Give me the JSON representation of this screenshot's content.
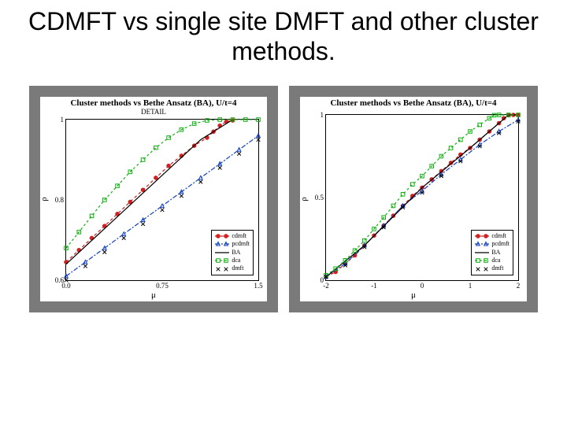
{
  "title": "CDMFT vs single site DMFT and  other cluster methods.",
  "chart_data": [
    {
      "type": "line",
      "title": "Cluster methods vs Bethe Ansatz (BA), U/t=4",
      "subtitle": "DETAIL",
      "xlabel": "μ",
      "ylabel": "ρ",
      "xlim": [
        0.5,
        2.0
      ],
      "ylim": [
        0.6,
        1.0
      ],
      "xticks": [
        0.5,
        1.25,
        2.0
      ],
      "xtick_labels": [
        "0.0",
        "0.75",
        "1.5"
      ],
      "yticks": [
        0.6,
        0.8,
        1.0
      ],
      "ytick_labels": [
        "0.6",
        "0.8",
        "1"
      ],
      "series": [
        {
          "name": "cdmft",
          "color": "#d02020",
          "marker": "circle-filled",
          "dash": "4,3",
          "x": [
            0.5,
            0.6,
            0.7,
            0.8,
            0.9,
            1.0,
            1.1,
            1.2,
            1.3,
            1.4,
            1.5,
            1.6,
            1.65,
            1.7,
            1.75,
            1.8
          ],
          "y": [
            0.645,
            0.675,
            0.705,
            0.735,
            0.765,
            0.795,
            0.825,
            0.855,
            0.885,
            0.91,
            0.935,
            0.955,
            0.97,
            0.985,
            0.995,
            0.998
          ]
        },
        {
          "name": "pcdmft",
          "color": "#1040c0",
          "marker": "triangle-open",
          "dash": "6,2,2,2",
          "x": [
            0.5,
            0.65,
            0.8,
            0.95,
            1.1,
            1.25,
            1.4,
            1.55,
            1.7,
            1.85,
            2.0
          ],
          "y": [
            0.61,
            0.645,
            0.68,
            0.715,
            0.75,
            0.785,
            0.82,
            0.855,
            0.89,
            0.925,
            0.96
          ]
        },
        {
          "name": "BA",
          "color": "#000000",
          "marker": "none",
          "dash": "",
          "x": [
            0.5,
            1.55,
            1.8
          ],
          "y": [
            0.64,
            0.95,
            1.0
          ]
        },
        {
          "name": "dca",
          "color": "#10b010",
          "marker": "square-open",
          "dash": "3,3",
          "x": [
            0.5,
            0.6,
            0.7,
            0.8,
            0.9,
            1.0,
            1.1,
            1.2,
            1.3,
            1.4,
            1.5,
            1.6,
            1.7,
            1.8,
            1.9,
            2.0
          ],
          "y": [
            0.68,
            0.72,
            0.76,
            0.8,
            0.835,
            0.87,
            0.9,
            0.93,
            0.955,
            0.975,
            0.99,
            0.998,
            1.0,
            1.0,
            1.0,
            1.0
          ]
        },
        {
          "name": "dmft",
          "color": "#000000",
          "marker": "x",
          "dash": "none",
          "x": [
            0.5,
            0.65,
            0.8,
            0.95,
            1.1,
            1.25,
            1.4,
            1.55,
            1.7,
            1.85,
            2.0
          ],
          "y": [
            0.6,
            0.635,
            0.67,
            0.705,
            0.74,
            0.775,
            0.81,
            0.845,
            0.88,
            0.915,
            0.95
          ]
        }
      ],
      "legend_pos": "lower-right"
    },
    {
      "type": "line",
      "title": "Cluster methods vs Bethe Ansatz (BA), U/t=4",
      "subtitle": "",
      "xlabel": "μ",
      "ylabel": "ρ",
      "xlim": [
        -2.0,
        2.0
      ],
      "ylim": [
        0.0,
        1.0
      ],
      "xticks": [
        -2,
        -1,
        0,
        1,
        2
      ],
      "xtick_labels": [
        "-2",
        "-1",
        "0",
        "1",
        "2"
      ],
      "yticks": [
        0.0,
        0.5,
        1.0
      ],
      "ytick_labels": [
        "0",
        "0.5",
        "1"
      ],
      "series": [
        {
          "name": "cdmft",
          "color": "#d02020",
          "marker": "circle-filled",
          "dash": "4,3",
          "x": [
            -2.0,
            -1.8,
            -1.6,
            -1.4,
            -1.2,
            -1.0,
            -0.8,
            -0.6,
            -0.4,
            -0.2,
            0.0,
            0.2,
            0.4,
            0.6,
            0.8,
            1.0,
            1.2,
            1.4,
            1.6,
            1.7,
            1.8,
            1.9,
            2.0
          ],
          "y": [
            0.02,
            0.05,
            0.1,
            0.15,
            0.21,
            0.27,
            0.33,
            0.39,
            0.45,
            0.51,
            0.56,
            0.61,
            0.66,
            0.71,
            0.76,
            0.8,
            0.85,
            0.9,
            0.95,
            0.98,
            0.998,
            1.0,
            1.0
          ]
        },
        {
          "name": "pcdmft",
          "color": "#1040c0",
          "marker": "triangle-open",
          "dash": "6,2,2,2",
          "x": [
            -2.0,
            -1.6,
            -1.2,
            -0.8,
            -0.4,
            0.0,
            0.4,
            0.8,
            1.2,
            1.6,
            2.0
          ],
          "y": [
            0.02,
            0.1,
            0.21,
            0.33,
            0.45,
            0.54,
            0.64,
            0.73,
            0.82,
            0.9,
            0.97
          ]
        },
        {
          "name": "BA",
          "color": "#000000",
          "marker": "none",
          "dash": "",
          "x": [
            -2.0,
            -1.2,
            0.0,
            1.0,
            1.6,
            1.8,
            2.0
          ],
          "y": [
            0.02,
            0.21,
            0.56,
            0.8,
            0.95,
            1.0,
            1.0
          ]
        },
        {
          "name": "dca",
          "color": "#10b010",
          "marker": "square-open",
          "dash": "3,3",
          "x": [
            -2.0,
            -1.8,
            -1.6,
            -1.4,
            -1.2,
            -1.0,
            -0.8,
            -0.6,
            -0.4,
            -0.2,
            0.0,
            0.2,
            0.4,
            0.6,
            0.8,
            1.0,
            1.2,
            1.4,
            1.5,
            1.6,
            1.8,
            2.0
          ],
          "y": [
            0.03,
            0.07,
            0.12,
            0.18,
            0.24,
            0.31,
            0.38,
            0.45,
            0.52,
            0.58,
            0.63,
            0.69,
            0.75,
            0.8,
            0.85,
            0.9,
            0.94,
            0.98,
            0.998,
            1.0,
            1.0,
            1.0
          ]
        },
        {
          "name": "dmft",
          "color": "#000000",
          "marker": "x",
          "dash": "none",
          "x": [
            -2.0,
            -1.6,
            -1.2,
            -0.8,
            -0.4,
            0.0,
            0.4,
            0.8,
            1.2,
            1.6,
            2.0
          ],
          "y": [
            0.02,
            0.09,
            0.2,
            0.32,
            0.44,
            0.53,
            0.63,
            0.72,
            0.81,
            0.89,
            0.96
          ]
        }
      ],
      "legend_pos": "lower-right"
    }
  ]
}
